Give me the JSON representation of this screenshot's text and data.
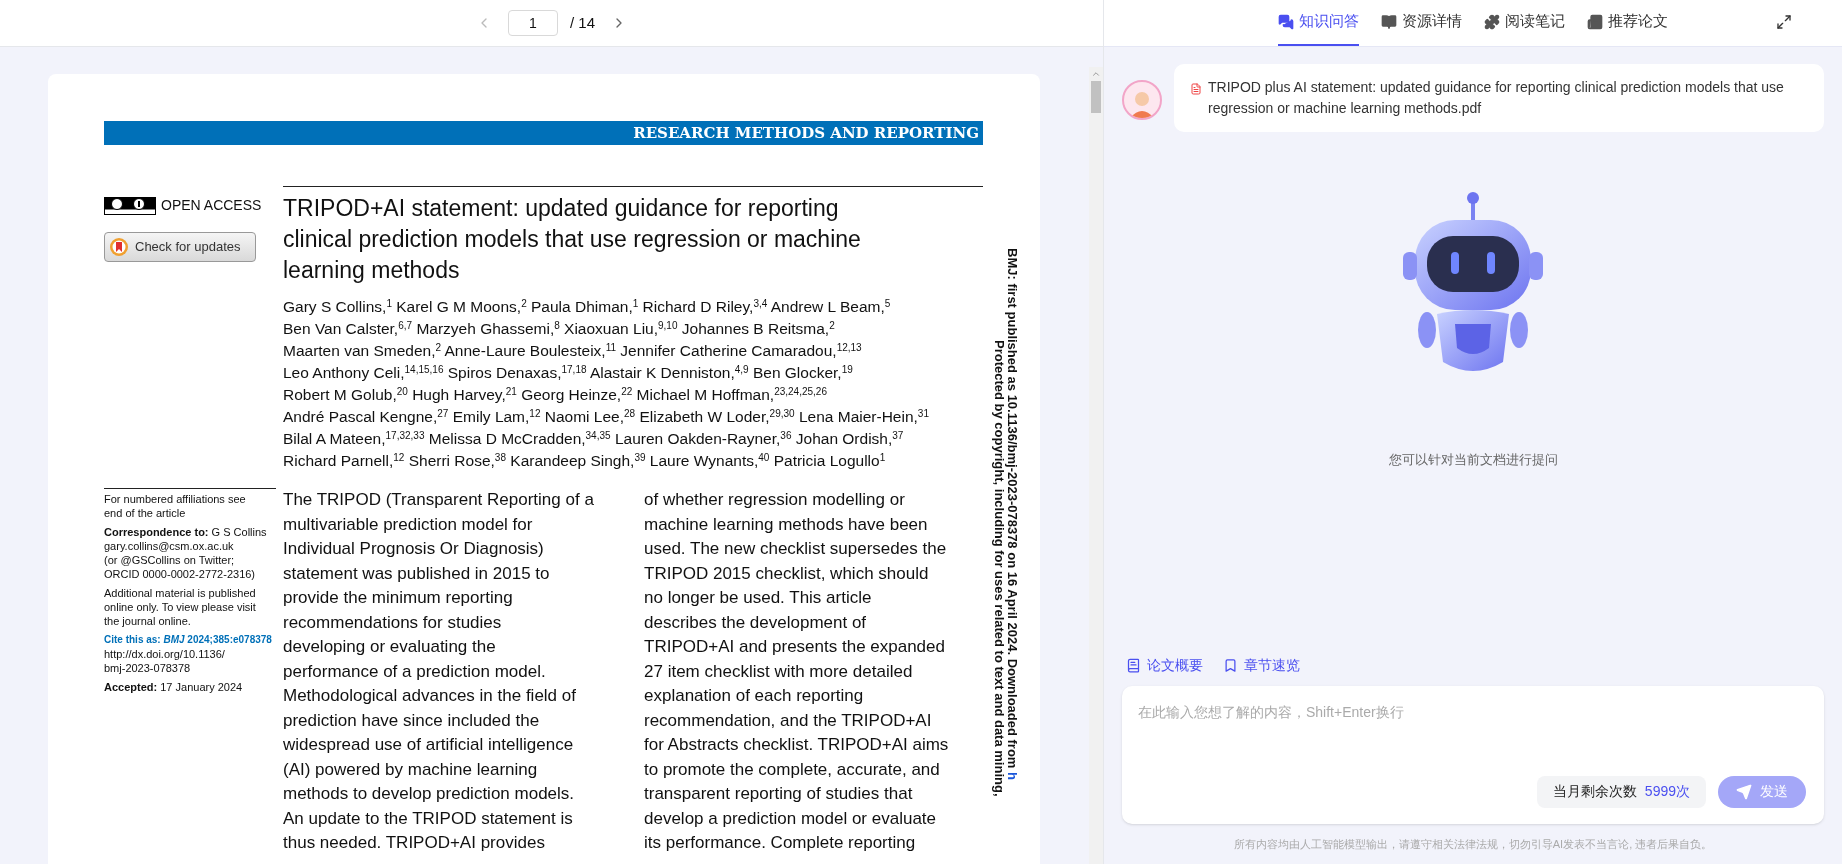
{
  "viewer": {
    "page_input": "1",
    "page_total": "/ 14"
  },
  "article": {
    "banner": "RESEARCH METHODS AND REPORTING",
    "license": "OPEN ACCESS",
    "update_button": "Check for updates",
    "title_lines": [
      "TRIPOD+AI statement: updated guidance for reporting",
      "clinical prediction models that use regression or machine",
      "learning methods"
    ],
    "author_lines": [
      "Gary S Collins,$^{1}$ Karel G M Moons,$^{2}$ Paula Dhiman,$^{1}$ Richard D Riley,$^{3,4}$ Andrew L Beam,$^{5}$",
      "Ben Van Calster,$^{6,7}$ Marzyeh Ghassemi,$^{8}$ Xiaoxuan Liu,$^{9,10}$ Johannes B Reitsma,$^{2}$",
      "Maarten van Smeden,$^{2}$ Anne-Laure Boulesteix,$^{11}$ Jennifer Catherine Camaradou,$^{12,13}$",
      "Leo Anthony Celi,$^{14,15,16}$ Spiros Denaxas,$^{17,18}$ Alastair K Denniston,$^{4,9}$ Ben Glocker,$^{19}$",
      "Robert M Golub,$^{20}$ Hugh Harvey,$^{21}$ Georg Heinze,$^{22}$ Michael M Hoffman,$^{23,24,25,26}$",
      "André Pascal Kengne,$^{27}$ Emily Lam,$^{12}$ Naomi Lee,$^{28}$ Elizabeth W Loder,$^{29,30}$ Lena Maier-Hein,$^{31}$",
      "Bilal A Mateen,$^{17,32,33}$ Melissa D McCradden,$^{34,35}$ Lauren Oakden-Rayner,$^{36}$ Johan Ordish,$^{37}$",
      "Richard Parnell,$^{12}$ Sherri Rose,$^{38}$ Karandeep Singh,$^{39}$ Laure Wynants,$^{40}$ Patricia Logullo$^{1}$"
    ],
    "sidebar_notes": [
      {
        "kind": "plain",
        "lines": [
          "For numbered affiliations see",
          "end of the article"
        ]
      },
      {
        "kind": "plain",
        "lines": [
          "**Correspondence to:** G S Collins",
          "gary.collins@csm.ox.ac.uk",
          "(or @GSCollins on Twitter;",
          "ORCID 0000-0002-2772-2316)"
        ]
      },
      {
        "kind": "plain",
        "lines": [
          "Additional material is published",
          "online only. To view please visit",
          "the journal online."
        ]
      },
      {
        "kind": "cite",
        "label": "Cite this as: *BMJ* 2024;385:e078378",
        "lines": [
          "http://dx.doi.org/10.1136/",
          "bmj-2023-078378"
        ]
      },
      {
        "kind": "plain",
        "lines": [
          "**Accepted:** 17 January 2024"
        ]
      }
    ],
    "columns": [
      [
        "The TRIPOD (Transparent Reporting of a",
        "multivariable prediction model for",
        "Individual Prognosis Or Diagnosis)",
        "statement was published in 2015 to",
        "provide the minimum reporting",
        "recommendations for studies",
        "developing or evaluating the",
        "performance of a prediction model.",
        "Methodological advances in the field of",
        "prediction have since included the",
        "widespread use of artificial intelligence",
        "(AI) powered by machine learning",
        "methods to develop prediction models.",
        "An update to the TRIPOD statement is",
        "thus needed. TRIPOD+AI provides"
      ],
      [
        "of whether regression modelling or",
        "machine learning methods have been",
        "used. The new checklist supersedes the",
        "TRIPOD 2015 checklist, which should",
        "no longer be used. This article",
        "describes the development of",
        "TRIPOD+AI and presents the expanded",
        "27 item checklist with more detailed",
        "explanation of each reporting",
        "recommendation, and the TRIPOD+AI",
        "for Abstracts checklist. TRIPOD+AI aims",
        "to promote the complete, accurate, and",
        "transparent reporting of studies that",
        "develop a prediction model or evaluate",
        "its performance. Complete reporting"
      ]
    ],
    "margin_notice": {
      "line_1": "BMJ: first published as 10.1136/bmj-2023-078378 on 16 April 2024. Downloaded from",
      "link": "h",
      "line_2": "Protected by copyright, including for uses related to text and data mining,"
    }
  },
  "assistant": {
    "tabs": [
      {
        "label": "知识问答",
        "selected": true
      },
      {
        "label": "资源详情",
        "selected": false
      },
      {
        "label": "阅读笔记",
        "selected": false
      },
      {
        "label": "推荐论文",
        "selected": false
      }
    ],
    "file_message": "TRIPOD plus AI statement: updated guidance for reporting clinical prediction models that use regression or machine learning methods.pdf",
    "empty_hint": "您可以针对当前文档进行提问",
    "quick_actions": [
      "论文概要",
      "章节速览"
    ],
    "input": {
      "placeholder": "在此输入您想了解的内容，Shift+Enter换行"
    },
    "quota": {
      "label": "当月剩余次数",
      "value": "5999次"
    },
    "send_button": "发送",
    "disclaimer": "所有内容均由人工智能模型输出，请遵守相关法律法规，切勿引导AI发表不当言论, 违者后果自负。"
  }
}
